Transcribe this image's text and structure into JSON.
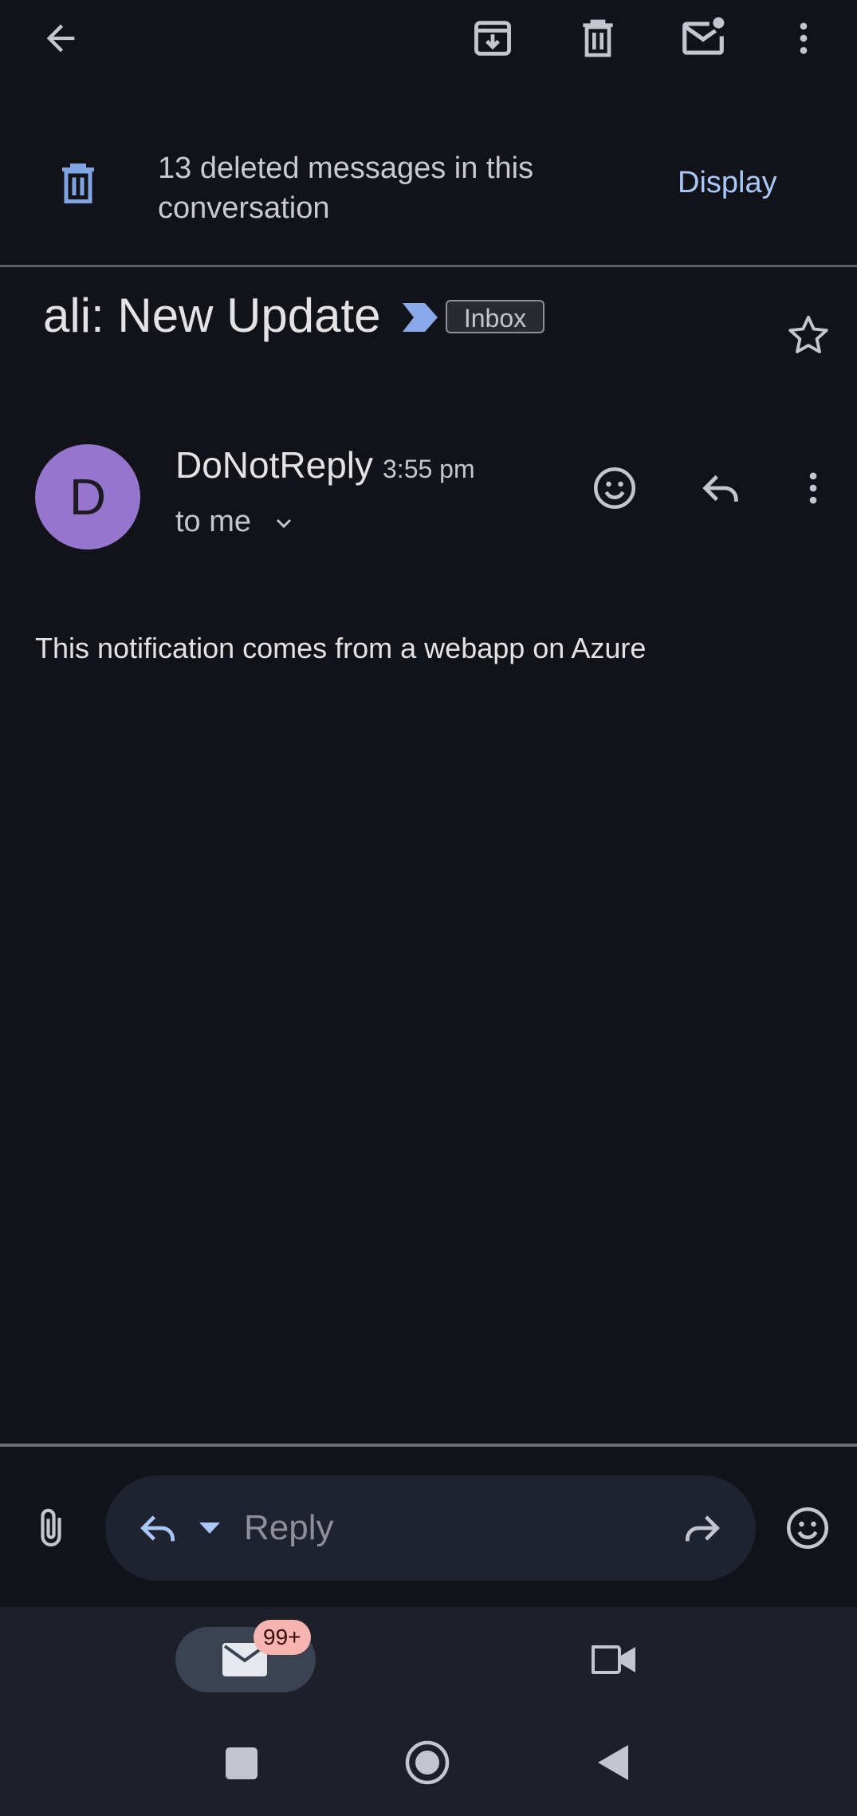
{
  "top_bar": {
    "icons": [
      "back-arrow-icon",
      "archive-icon",
      "delete-icon",
      "mark-unread-icon",
      "more-vertical-icon"
    ]
  },
  "deleted_banner": {
    "text": "13 deleted messages in this conversation",
    "action_label": "Display"
  },
  "email": {
    "subject": "ali: New Update",
    "label_chip": "Inbox",
    "sender": {
      "initial": "D",
      "name": "DoNotReply",
      "time": "3:55 pm",
      "recipient": "to me"
    },
    "body": "This notification comes from a webapp on Azure"
  },
  "composer": {
    "placeholder": "Reply"
  },
  "bottom_nav": {
    "mail_badge": "99+"
  },
  "colors": {
    "background": "#121318",
    "accent": "#a8c7fa",
    "avatar": "#9575cd",
    "badge": "#f5b4b0"
  }
}
